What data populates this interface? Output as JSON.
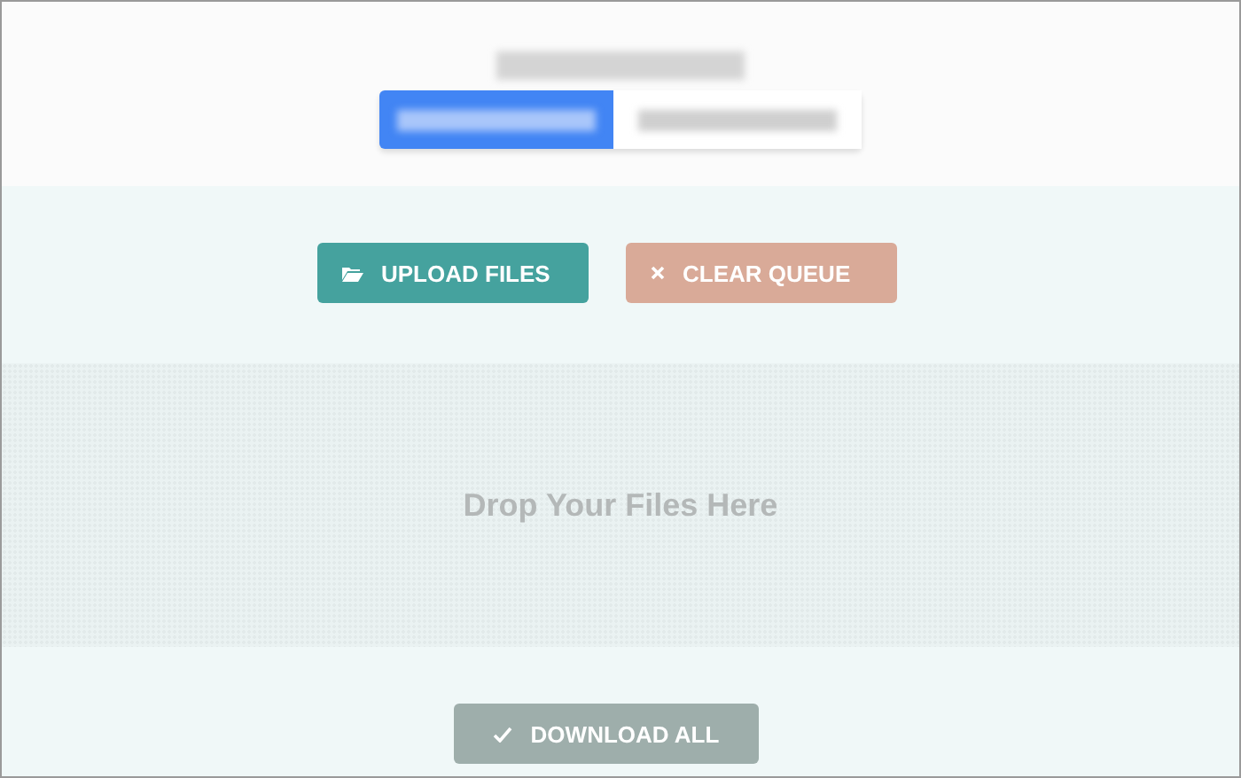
{
  "ad": {
    "kind": "blurred"
  },
  "actions": [
    {
      "kind": "upload",
      "label": "UPLOAD FILES",
      "disabled": false
    },
    {
      "kind": "clear",
      "label": "CLEAR QUEUE",
      "disabled": true
    }
  ],
  "dropzone": {
    "text": "Drop Your Files Here"
  },
  "download": {
    "label": "DOWNLOAD ALL",
    "disabled": true
  }
}
